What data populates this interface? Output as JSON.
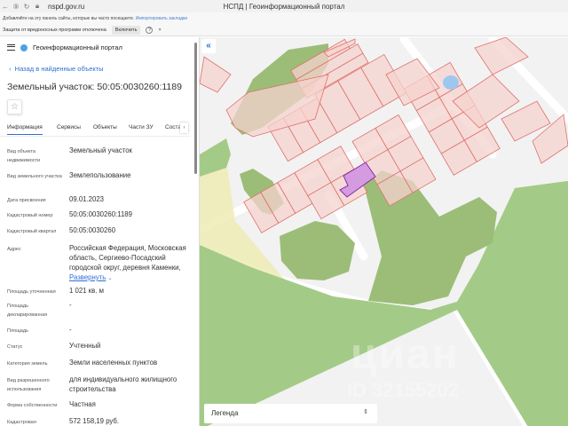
{
  "browser": {
    "url": "nspd.gov.ru",
    "title": "НСПД | Геоинформационный портал",
    "bookmarks_hint": "Добавляйте на эту панель сайты, которые вы часто посещаете.",
    "bookmarks_link": "Импортировать закладки",
    "protection_text": "Защита от вредоносных программ отключена",
    "protection_button": "Включить",
    "help": "?",
    "close": "×"
  },
  "app": {
    "title": "Геоинформационный портал",
    "back_link": "Назад в найденные объекты",
    "page_title": "Земельный участок: 50:05:0030260:1189",
    "tabs": [
      "Информация",
      "Сервисы",
      "Объекты",
      "Части ЗУ",
      "Состав"
    ]
  },
  "fields": [
    {
      "label": "Вид объекта недвижимости",
      "value": "Земельный участок"
    },
    {
      "label": "Вид земельного участка",
      "value": "Землепользование"
    },
    {
      "label": "Дата присвоения",
      "value": "09.01.2023"
    },
    {
      "label": "Кадастровый номер",
      "value": "50:05:0030260:1189"
    },
    {
      "label": "Кадастровый квартал",
      "value": "50:05:0030260"
    },
    {
      "label": "Адрес",
      "value": "Российская Федерация, Московская область, Сергиево-Посадский городской округ, деревня Каменки,",
      "expand": "Развернуть"
    },
    {
      "label": "Площадь уточненная",
      "value": "1 021 кв. м"
    },
    {
      "label": "Площадь декларированная",
      "value": "-"
    },
    {
      "label": "Площадь",
      "value": "-"
    },
    {
      "label": "Статус",
      "value": "Учтенный"
    },
    {
      "label": "Категория земель",
      "value": "Земли населенных пунктов"
    },
    {
      "label": "Вид разрешенного использования",
      "value": "для индивидуального жилищного строительства"
    },
    {
      "label": "Форма собственности",
      "value": "Частная"
    },
    {
      "label": "Кадастровая",
      "value": "572 158,19 руб."
    }
  ],
  "map": {
    "legend": "Легенда",
    "watermark_brand": "циан",
    "watermark_id": "ID 32155202"
  },
  "colors": {
    "accent": "#2f6fd3",
    "parcel": "#f6d3cf",
    "parcel_stroke": "#e0706a",
    "selected": "#c98ad8",
    "green": "#9bc47f"
  }
}
